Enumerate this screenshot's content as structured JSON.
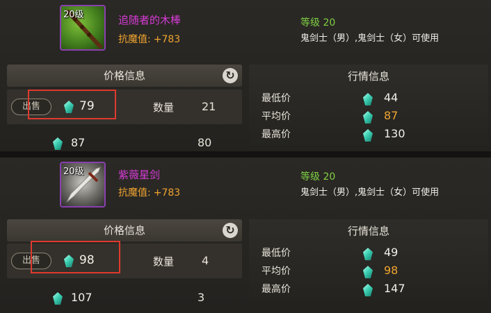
{
  "items": [
    {
      "level_badge": "20级",
      "name": "追随者的木棒",
      "resist_label": "抗魔值:",
      "resist_value": "+783",
      "level_req": "等级 20",
      "classes": "鬼剑士（男）,鬼剑士（女）可使用",
      "price_header": "价格信息",
      "sell_label": "出售",
      "my_price": "79",
      "qty_label": "数量",
      "my_qty": "21",
      "other_price": "87",
      "other_qty": "80",
      "market_title": "行情信息",
      "min_label": "最低价",
      "min_value": "44",
      "avg_label": "平均价",
      "avg_value": "87",
      "max_label": "最高价",
      "max_value": "130"
    },
    {
      "level_badge": "20级",
      "name": "紫薇星剑",
      "resist_label": "抗魔值:",
      "resist_value": "+783",
      "level_req": "等级 20",
      "classes": "鬼剑士（男）,鬼剑士（女）可使用",
      "price_header": "价格信息",
      "sell_label": "出售",
      "my_price": "98",
      "qty_label": "数量",
      "my_qty": "4",
      "other_price": "107",
      "other_qty": "3",
      "market_title": "行情信息",
      "min_label": "最低价",
      "min_value": "49",
      "avg_label": "平均价",
      "avg_value": "98",
      "max_label": "最高价",
      "max_value": "147"
    }
  ],
  "icons": {
    "refresh": "refresh-icon",
    "currency": "gem-icon"
  },
  "colors": {
    "item_name": "#d83bd8",
    "resist": "#f1a531",
    "level_req": "#7fd144",
    "highlight": "#e03a2f"
  }
}
